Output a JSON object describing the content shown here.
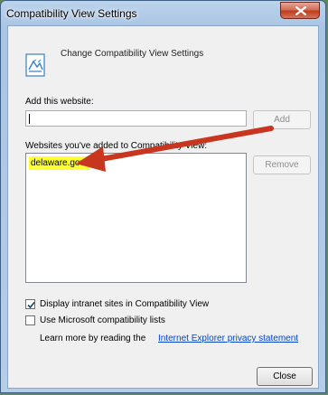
{
  "window": {
    "title": "Compatibility View Settings",
    "close_icon": "close-x-icon"
  },
  "header": {
    "title": "Change Compatibility View Settings",
    "icon": "compatibility-view-icon"
  },
  "add_website": {
    "label": "Add this website:",
    "value": "",
    "add_label": "Add"
  },
  "websites": {
    "label": "Websites you've added to Compatibility View:",
    "items": [
      "delaware.gov"
    ],
    "remove_label": "Remove",
    "highlight_color": "#fdff32"
  },
  "options": {
    "intranet_label": "Display intranet sites in Compatibility View",
    "intranet_checked": true,
    "ms_lists_label": "Use Microsoft compatibility lists",
    "ms_lists_checked": false
  },
  "privacy": {
    "prefix": "Learn more by reading the",
    "link_text": "Internet Explorer privacy statement"
  },
  "footer": {
    "close_label": "Close"
  },
  "annotation": {
    "arrow_color": "#c8361f"
  }
}
